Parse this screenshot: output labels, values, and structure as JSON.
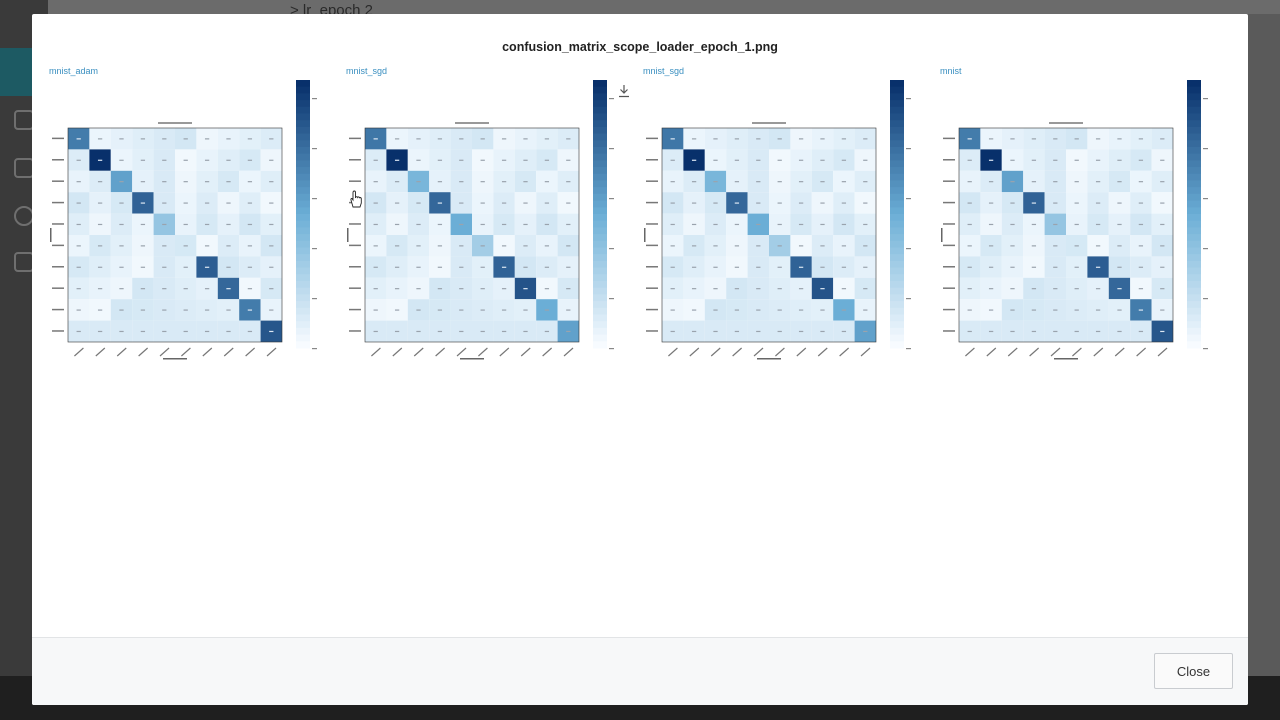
{
  "background": {
    "breadcrumb": "> lr_epoch  2"
  },
  "modal": {
    "title": "confusion_matrix_scope_loader_epoch_1.png",
    "close_label": "Close",
    "panels": [
      {
        "label": "mnist_adam",
        "diag": [
          0.7,
          1.0,
          0.55,
          0.8,
          0.35,
          0.12,
          0.82,
          0.78,
          0.7,
          0.85
        ]
      },
      {
        "label": "mnist_sgd",
        "diag": [
          0.72,
          1.0,
          0.45,
          0.78,
          0.5,
          0.3,
          0.8,
          0.86,
          0.5,
          0.55
        ]
      },
      {
        "label": "mnist_sgd",
        "diag": [
          0.72,
          1.0,
          0.45,
          0.78,
          0.5,
          0.3,
          0.8,
          0.86,
          0.5,
          0.55
        ]
      },
      {
        "label": "mnist",
        "diag": [
          0.7,
          1.0,
          0.55,
          0.8,
          0.35,
          0.12,
          0.82,
          0.78,
          0.7,
          0.85
        ]
      }
    ]
  },
  "colors": {
    "accent": "#3a8fc0",
    "heat_low": "#f7fbff",
    "heat_high": "#08306b"
  }
}
